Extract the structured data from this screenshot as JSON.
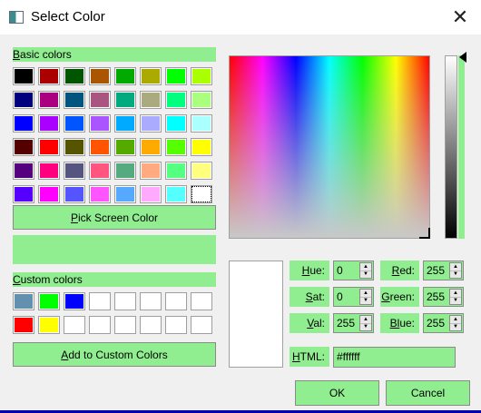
{
  "window": {
    "title": "Select Color",
    "close_glyph": "✕",
    "icon": "app-window-icon"
  },
  "basic_colors": {
    "label_prefix": "B",
    "label_rest": "asic colors",
    "swatches": [
      "#000000",
      "#aa0000",
      "#005500",
      "#aa5500",
      "#00aa00",
      "#aaaa00",
      "#00ff00",
      "#aaff00",
      "#00007f",
      "#aa007f",
      "#00557f",
      "#aa557f",
      "#00aa7f",
      "#aaaa7f",
      "#00ff7f",
      "#aaff7f",
      "#0000ff",
      "#aa00ff",
      "#0055ff",
      "#aa55ff",
      "#00aaff",
      "#aaaaff",
      "#00ffff",
      "#aaffff",
      "#550000",
      "#ff0000",
      "#555500",
      "#ff5500",
      "#55aa00",
      "#ffaa00",
      "#55ff00",
      "#ffff00",
      "#55007f",
      "#ff007f",
      "#55557f",
      "#ff557f",
      "#55aa7f",
      "#ffaa7f",
      "#55ff7f",
      "#ffff7f",
      "#5500ff",
      "#ff00ff",
      "#5555ff",
      "#ff55ff",
      "#55aaff",
      "#ffaaff",
      "#55ffff",
      "#ffffff"
    ],
    "selected_index": 47
  },
  "pick_screen_button": {
    "prefix": "P",
    "rest": "ick Screen Color"
  },
  "custom_colors": {
    "label_prefix": "C",
    "label_rest": "ustom colors",
    "swatches": [
      "#6490b0",
      "#00ff00",
      "#0000ff",
      "#ffffff",
      "#ffffff",
      "#ffffff",
      "#ffffff",
      "#ffffff",
      "#ff0000",
      "#ffff00",
      "#ffffff",
      "#ffffff",
      "#ffffff",
      "#ffffff",
      "#ffffff",
      "#ffffff"
    ]
  },
  "add_custom_button": {
    "prefix": "A",
    "rest": "dd to Custom Colors"
  },
  "fields": {
    "hue": {
      "prefix": "H",
      "rest": "ue:",
      "value": "0"
    },
    "sat": {
      "prefix": "S",
      "rest": "at:",
      "value": "0"
    },
    "val": {
      "prefix": "V",
      "rest": "al:",
      "value": "255"
    },
    "red": {
      "prefix": "R",
      "rest": "ed:",
      "value": "255"
    },
    "green": {
      "prefix": "G",
      "rest": "reen:",
      "value": "255"
    },
    "blue": {
      "prefix": "Bl",
      "rest": "ue:",
      "value": "255"
    },
    "html": {
      "prefix": "H",
      "rest": "TML:",
      "value": "#ffffff"
    }
  },
  "spin_up_glyph": "▲",
  "spin_down_glyph": "▼",
  "ok_button": "OK",
  "cancel_button": "Cancel",
  "current_color": "#ffffff",
  "accent": "#90ee90"
}
